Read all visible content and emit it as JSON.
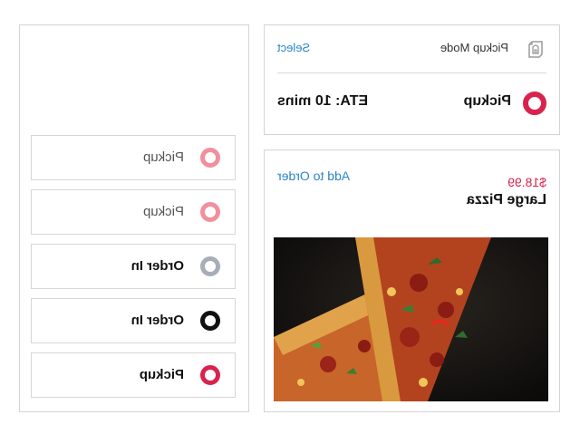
{
  "mode_card": {
    "header_title": "Pickup Mode",
    "select_label": "Select",
    "selected_label": "Pickup",
    "eta": "ETA: 10 mins",
    "icon": "shopping-bag-icon",
    "accent": "#d9234d",
    "link_color": "#2b86c5"
  },
  "product_card": {
    "name": "Large Pizza",
    "price": "$18.99",
    "add_label": "Add to Order",
    "image": "pizza-slice-photo"
  },
  "options": [
    {
      "label": "Pickup",
      "state": "faded",
      "color": "#f1909c"
    },
    {
      "label": "Pickup",
      "state": "faded",
      "color": "#f1909c"
    },
    {
      "label": "Order In",
      "state": "gray",
      "color": "#a7aeb8"
    },
    {
      "label": "Order In",
      "state": "selected-black",
      "color": "#111111"
    },
    {
      "label": "Pickup",
      "state": "selected-red",
      "color": "#d9234d"
    }
  ]
}
